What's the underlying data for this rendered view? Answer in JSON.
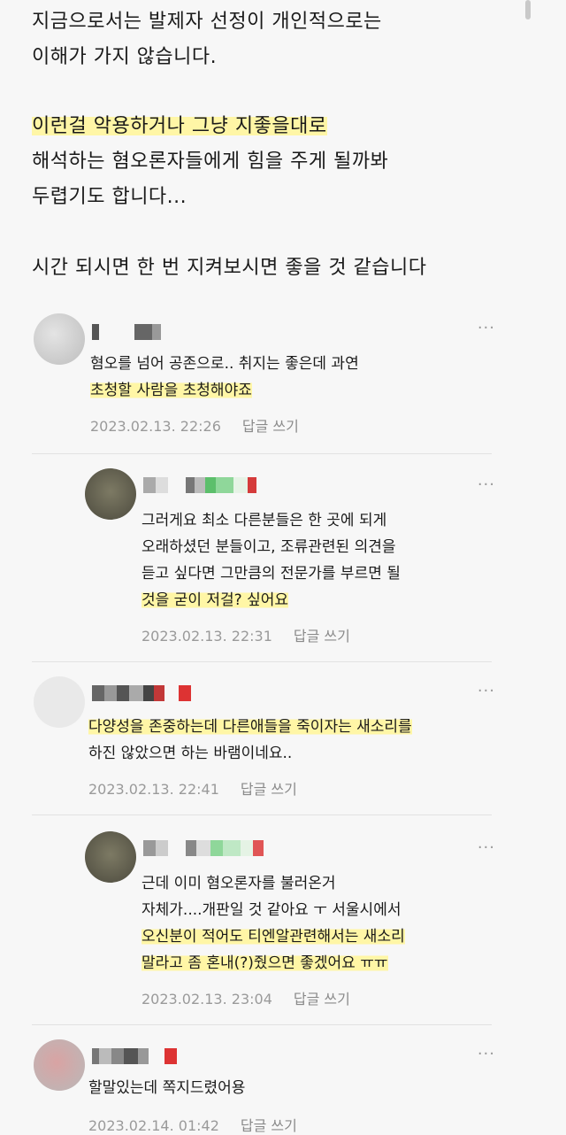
{
  "post": {
    "lines": [
      "지금으로서는 발제자 선정이 개인적으로는",
      "이해가 가지 않습니다.",
      "이런걸 악용하거나 그냥 지좋을대로",
      "해석하는 혐오론자들에게 힘을 주게 될까봐",
      "두렵기도 합니다...",
      "시간 되시면 한 번 지켜보시면 좋을 것 같습니다"
    ]
  },
  "comments": [
    {
      "more": "···",
      "lines": [
        "혐오를 넘어 공존으로.. 취지는 좋은데 과연",
        "초청할 사람을 초청해야죠"
      ],
      "date": "2023.02.13. 22:26",
      "reply_label": "답글 쓰기"
    },
    {
      "more": "···",
      "lines": [
        "그러게요 최소 다른분들은 한 곳에 되게",
        "오래하셨던 분들이고, 조류관련된 의견을",
        "듣고 싶다면 그만큼의 전문가를 부르면 될",
        "것을 굳이 저걸? 싶어요"
      ],
      "date": "2023.02.13. 22:31",
      "reply_label": "답글 쓰기"
    },
    {
      "more": "···",
      "lines": [
        "다양성을 존중하는데 다른애들을 죽이자는 새소리를",
        "하진 않았으면 하는 바램이네요.."
      ],
      "date": "2023.02.13. 22:41",
      "reply_label": "답글 쓰기"
    },
    {
      "more": "···",
      "lines": [
        "근데 이미 혐오론자를 불러온거",
        "자체가....개판일 것 같아요 ㅜ 서울시에서",
        "오신분이 적어도 티엔알관련해서는 새소리",
        "말라고 좀 혼내(?)줬으면 좋겠어요 ㅠㅠ"
      ],
      "date": "2023.02.13. 23:04",
      "reply_label": "답글 쓰기"
    },
    {
      "more": "···",
      "lines": [
        "할말있는데 쪽지드렸어용"
      ],
      "date": "2023.02.14. 01:42",
      "reply_label": "답글 쓰기"
    }
  ]
}
